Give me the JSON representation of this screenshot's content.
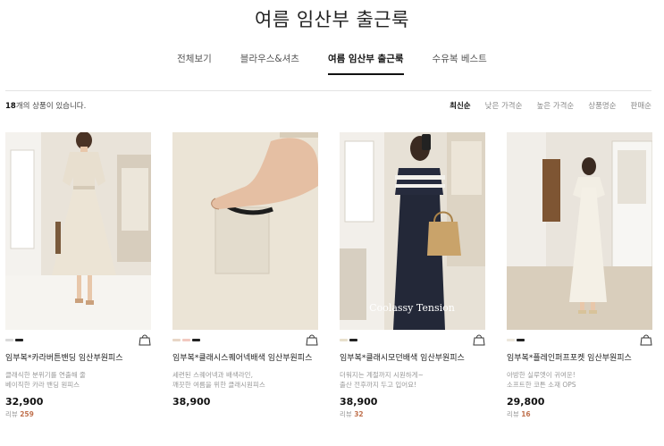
{
  "page": {
    "title": "여름 임산부 출근룩"
  },
  "tabs": [
    {
      "label": "전체보기",
      "active": false
    },
    {
      "label": "블라우스&셔츠",
      "active": false
    },
    {
      "label": "여름 임산부 출근룩",
      "active": true
    },
    {
      "label": "수유복 베스트",
      "active": false
    }
  ],
  "listing": {
    "count_number": "18",
    "count_suffix": "개의 상품이 있습니다."
  },
  "sort_options": [
    {
      "label": "최신순",
      "active": true
    },
    {
      "label": "낮은 가격순",
      "active": false
    },
    {
      "label": "높은 가격순",
      "active": false
    },
    {
      "label": "상품명순",
      "active": false
    },
    {
      "label": "판매순",
      "active": false
    }
  ],
  "products": [
    {
      "name": "임부복*카라버튼밴딩 임산부원피스",
      "desc_line1": "클래식한 분위기를 연출해 줄",
      "desc_line2": "베이직한 카라 밴딩 원피스",
      "price": "32,900",
      "review_label": "리뷰",
      "review_count": "259",
      "swatches": [
        "#d9d9d9",
        "#222222"
      ]
    },
    {
      "name": "임부복*클래시스퀘어넥배색 임산부원피스",
      "desc_line1": "세련된 스퀘어넥과 배색라인,",
      "desc_line2": "깨끗한 여름을 위한 클래시원피스",
      "price": "38,900",
      "review_label": "",
      "review_count": "",
      "swatches": [
        "#e8d6c6",
        "#f2c9c0",
        "#222222"
      ]
    },
    {
      "name": "임부복*클래시모던배색 임산부원피스",
      "desc_line1": "더워지는 계절까지 시원하게~",
      "desc_line2": "출산 전후까지 두고 입어요!",
      "price": "38,900",
      "review_label": "리뷰",
      "review_count": "32",
      "swatches": [
        "#e8e0cc",
        "#222222"
      ]
    },
    {
      "name": "임부복*플레인퍼프포켓 임산부원피스",
      "desc_line1": "아방한 실루엣이 귀여운!",
      "desc_line2": "소프트한 코튼 소재 OPS",
      "price": "29,800",
      "review_label": "리뷰",
      "review_count": "16",
      "swatches": [
        "#ece7dc",
        "#222222"
      ]
    }
  ],
  "watermark": "Coolassy Tension",
  "icons": {
    "cart": "shopping-bag-icon"
  }
}
